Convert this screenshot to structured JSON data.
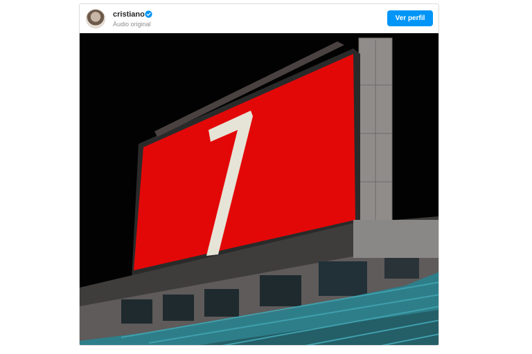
{
  "post": {
    "username": "cristiano",
    "subtitle": "Áudio original",
    "view_profile_label": "Ver perfil"
  },
  "media": {
    "scoreboard_number": "7",
    "scoreboard_color": "#e30808",
    "accent": "#0095f6"
  }
}
